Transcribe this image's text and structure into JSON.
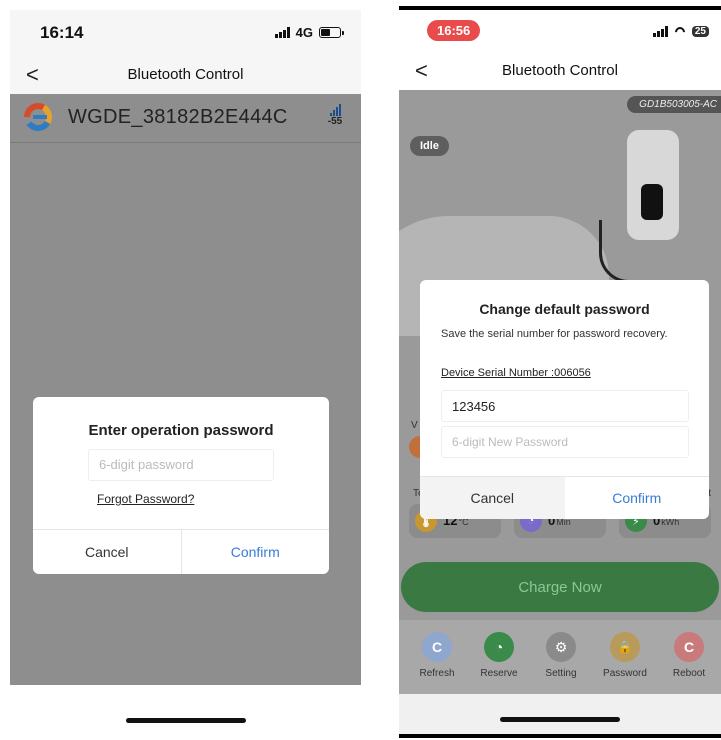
{
  "left": {
    "status": {
      "time": "16:14",
      "network": "4G"
    },
    "nav": {
      "back": "<",
      "title": "Bluetooth Control"
    },
    "device": {
      "name": "WGDE_38182B2E444C",
      "rssi": "-55"
    },
    "dialog": {
      "title": "Enter operation password",
      "placeholder": "6-digit password",
      "forgot": "Forgot Password?",
      "cancel": "Cancel",
      "confirm": "Confirm"
    }
  },
  "right": {
    "status": {
      "time": "16:56",
      "battery": "25"
    },
    "nav": {
      "back": "<",
      "title": "Bluetooth Control"
    },
    "device_sn": "GD1B503005-AC",
    "state": "Idle",
    "stats_row1_partial": "V",
    "stats_row2_partial_left": "Te",
    "stats_row2_partial_right": "t",
    "stats": [
      {
        "value": "12",
        "unit": "°C"
      },
      {
        "value": "0",
        "unit": "Min"
      },
      {
        "value": "0",
        "unit": "kWh"
      }
    ],
    "charge_button": "Charge Now",
    "bottom_nav": [
      {
        "label": "Refresh",
        "icon": "refresh-icon",
        "glyph": "C",
        "color": "#6a8cc8"
      },
      {
        "label": "Reserve",
        "icon": "clock-icon",
        "glyph": "◔",
        "color": "#3a8a4a"
      },
      {
        "label": "Setting",
        "icon": "gear-icon",
        "glyph": "⚙",
        "color": "#7a7a7a"
      },
      {
        "label": "Password",
        "icon": "lock-icon",
        "glyph": "🔒",
        "color": "#c9972f"
      },
      {
        "label": "Reboot",
        "icon": "reboot-icon",
        "glyph": "C",
        "color": "#d94b4b"
      }
    ],
    "dialog": {
      "title": "Change default password",
      "description": "Save the serial number for password recovery.",
      "serial": "Device Serial Number :006056",
      "password_value": "123456",
      "new_password_placeholder": "6-digit New Password",
      "cancel": "Cancel",
      "confirm": "Confirm"
    }
  },
  "colors": {
    "accent": "#3a7bd5",
    "charge": "#3a7a42",
    "time_pill": "#e94b4b"
  }
}
